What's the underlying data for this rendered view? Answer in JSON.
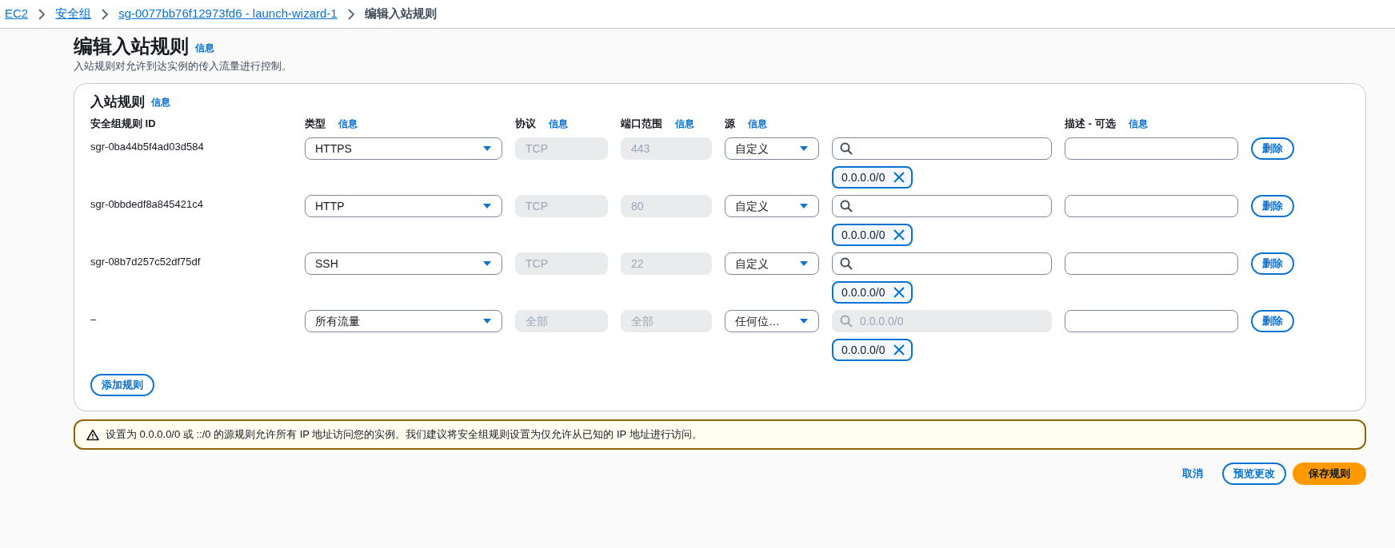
{
  "breadcrumb": [
    {
      "label": "EC2",
      "kind": "link"
    },
    {
      "label": "安全组",
      "kind": "link"
    },
    {
      "label": "sg-0077bb76f12973fd6 - launch-wizard-1",
      "kind": "link"
    },
    {
      "label": "编辑入站规则",
      "kind": "current"
    }
  ],
  "header": {
    "title": "编辑入站规则",
    "info_link": "信息",
    "description": "入站规则对允许到达实例的传入流量进行控制。"
  },
  "rules_panel": {
    "title": "入站规则",
    "info_link": "信息",
    "columns": [
      {
        "label": "安全组规则 ID"
      },
      {
        "label": "类型",
        "info": "信息"
      },
      {
        "label": "协议",
        "info": "信息"
      },
      {
        "label": "端口范围",
        "info": "信息"
      },
      {
        "label": "源",
        "info": "信息"
      },
      {
        "label": "描述 - 可选",
        "info": "信息"
      }
    ],
    "rows": [
      {
        "id": "sgr-0ba44b5f4ad03d584",
        "type": "HTTPS",
        "protocol": "TCP",
        "port_range": "443",
        "source": "自定义",
        "source_search": {
          "disabled": false
        },
        "token": "0.0.0.0/0",
        "delete": "删除"
      },
      {
        "id": "sgr-0bbdedf8a845421c4",
        "type": "HTTP",
        "protocol": "TCP",
        "port_range": "80",
        "source": "自定义",
        "source_search": {
          "disabled": false
        },
        "token": "0.0.0.0/0",
        "delete": "删除"
      },
      {
        "id": "sgr-08b7d257c52df75df",
        "type": "SSH",
        "protocol": "TCP",
        "port_range": "22",
        "source": "自定义",
        "source_search": {
          "disabled": false
        },
        "token": "0.0.0.0/0",
        "delete": "删除"
      },
      {
        "id": "–",
        "type": "所有流量",
        "protocol": "全部",
        "port_range": "全部",
        "source": "任何位…",
        "source_search": {
          "disabled": true,
          "value": "0.0.0.0/0"
        },
        "token": "0.0.0.0/0",
        "delete": "删除"
      }
    ],
    "add_button": "添加规则"
  },
  "warning": "设置为 0.0.0.0/0 或 ::/0 的源规则允许所有 IP 地址访问您的实例。我们建议将安全组规则设置为仅允许从已知的 IP 地址进行访问。",
  "actions": {
    "cancel": "取消",
    "preview": "预览更改",
    "save": "保存规则"
  }
}
